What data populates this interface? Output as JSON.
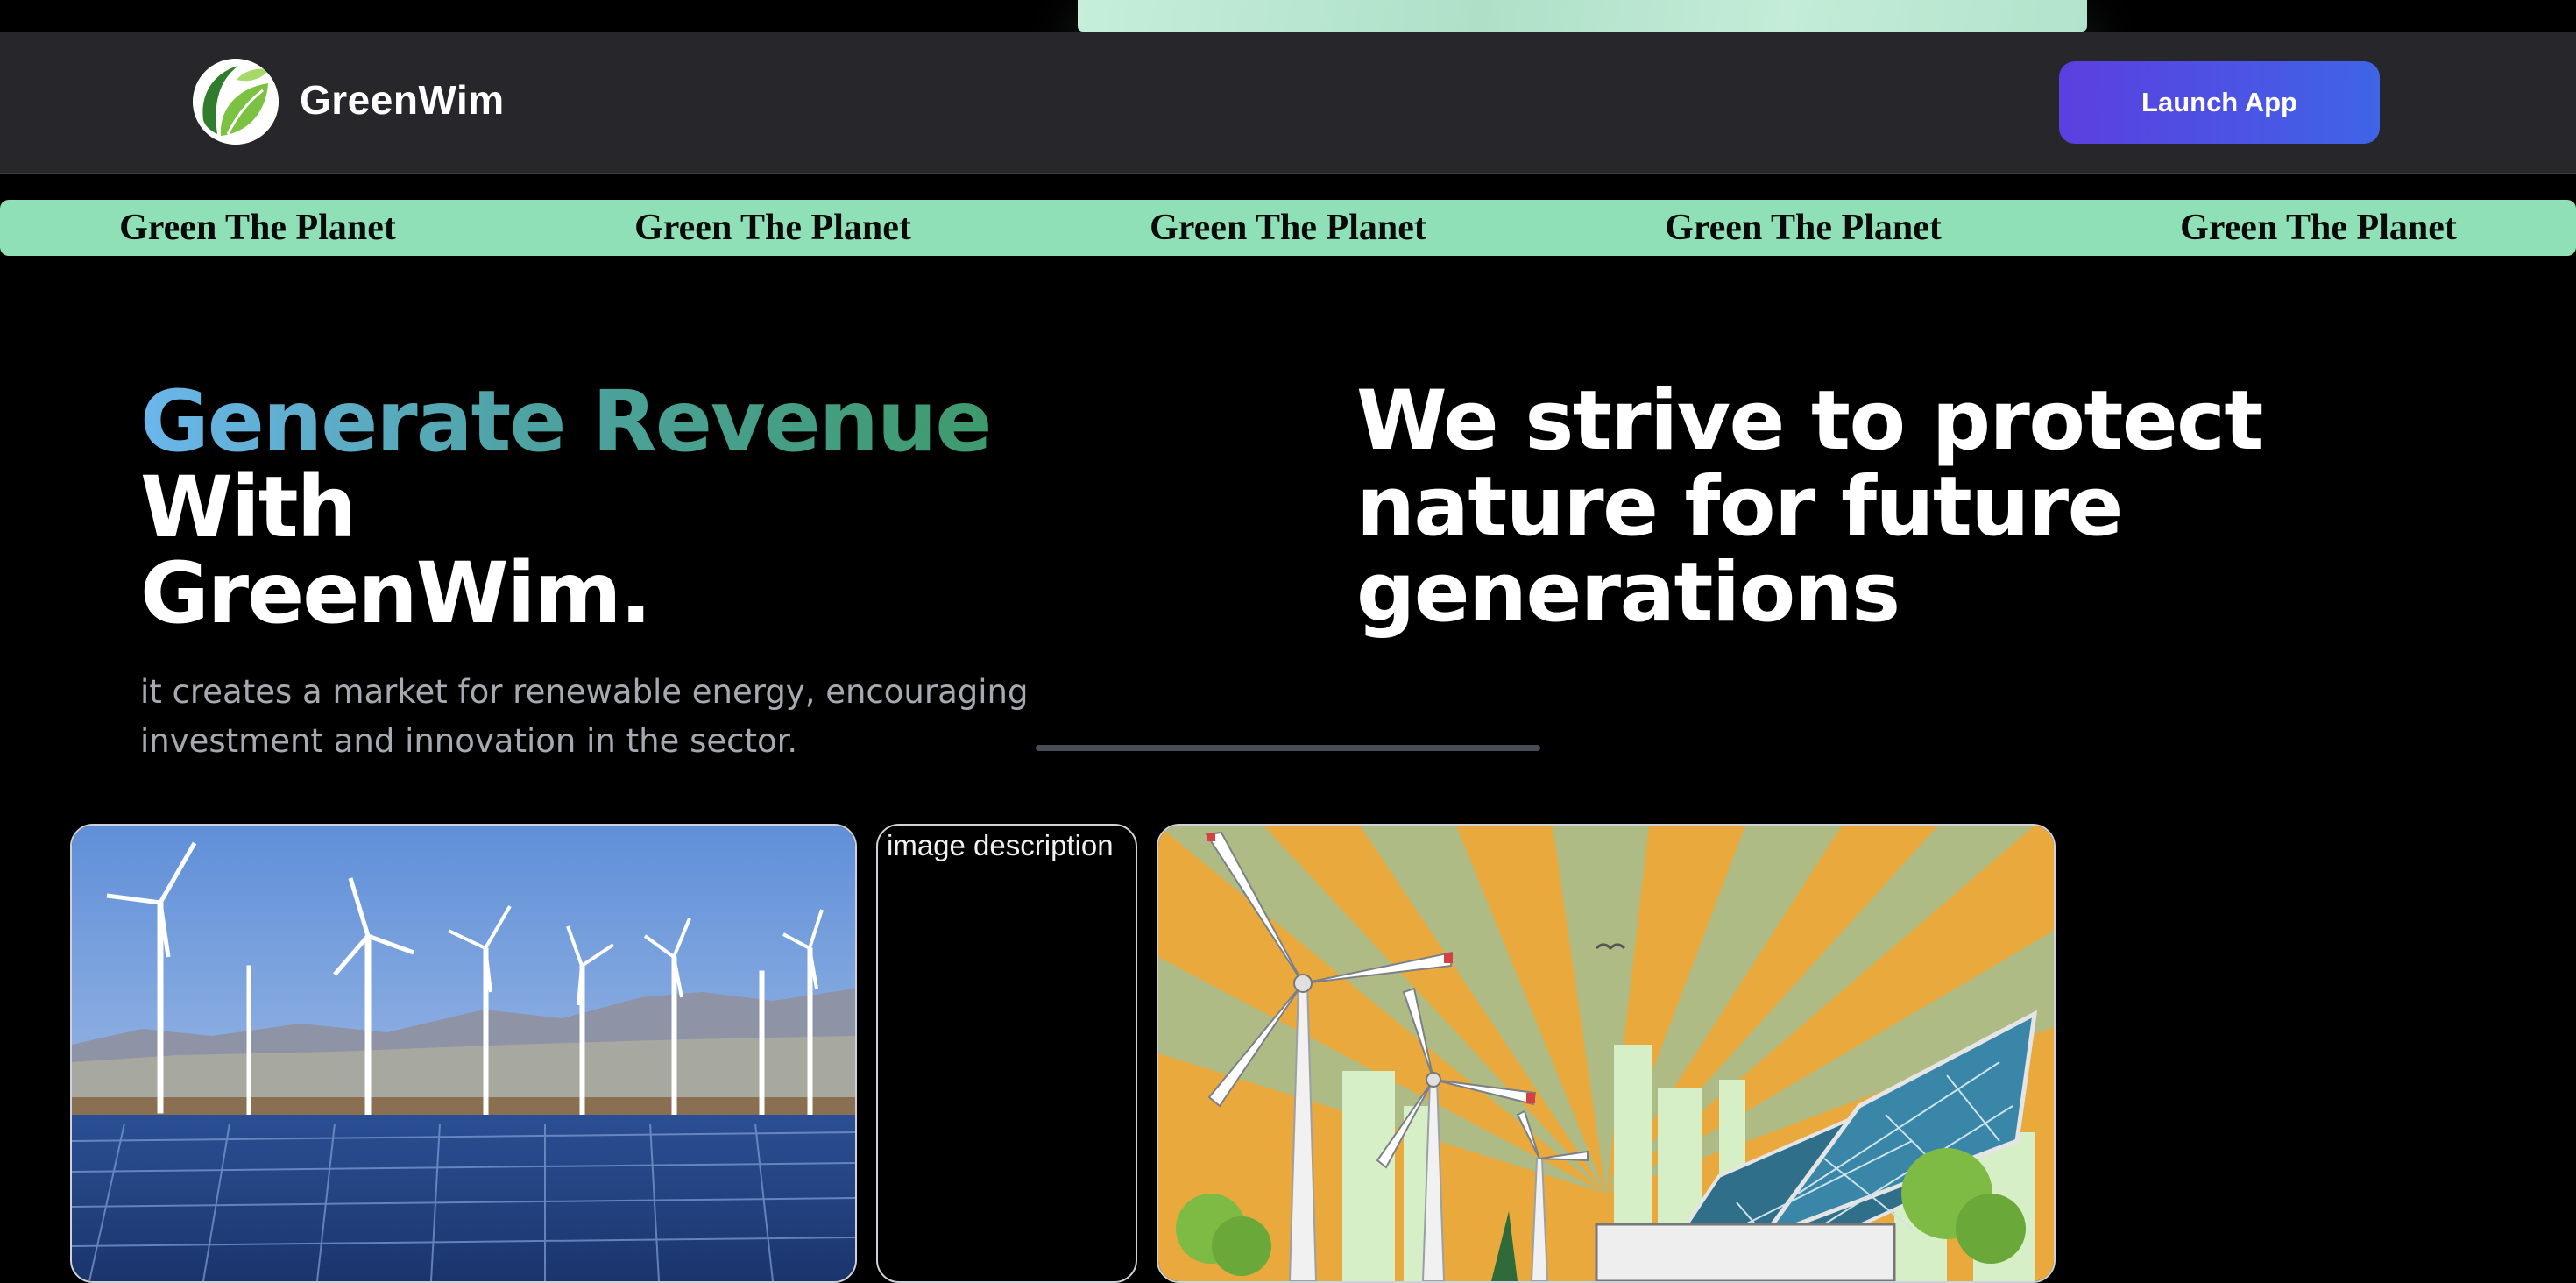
{
  "header": {
    "brand": "GreenWim",
    "launch_label": "Launch App"
  },
  "ticker": {
    "items": [
      "Green The Planet",
      "Green The Planet",
      "Green The Planet",
      "Green The Planet",
      "Green The Planet"
    ]
  },
  "hero": {
    "title_gradient": "Generate Revenue",
    "title_rest_1": "With",
    "title_rest_2": "GreenWim.",
    "description": "it creates a market for renewable energy, encouraging investment and innovation in the sector.",
    "tagline": "We strive to protect nature for future generations"
  },
  "gallery": {
    "broken_alt": "image description"
  },
  "colors": {
    "ticker_bg": "#8fe0b7",
    "button_gradient_start": "#5b3fe0",
    "button_gradient_end": "#3f64e6",
    "title_gradient_start": "#6bb6ec",
    "title_gradient_end": "#3e9a6d"
  }
}
